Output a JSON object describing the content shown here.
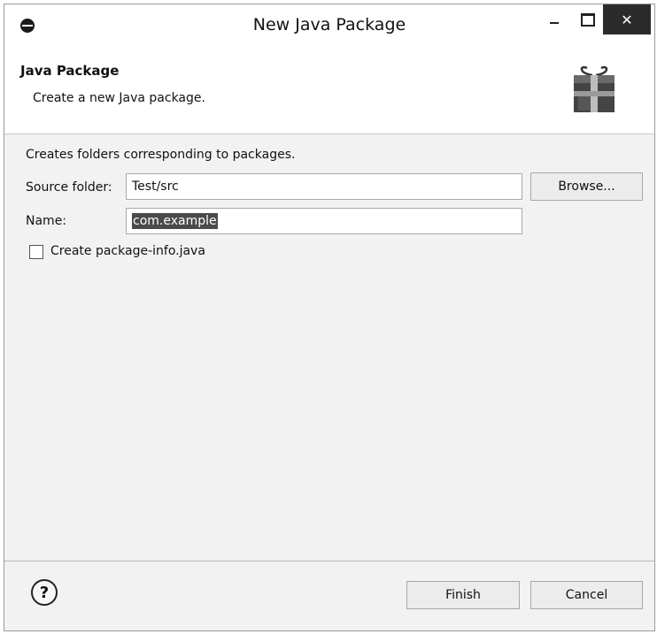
{
  "window": {
    "title": "New Java Package",
    "close_glyph": "✕"
  },
  "banner": {
    "title": "Java Package",
    "description": "Create a new Java package.",
    "icon": "package-icon"
  },
  "form": {
    "intro": "Creates folders corresponding to packages.",
    "source_folder_label": "Source folder:",
    "source_folder_value": "Test/src",
    "browse_label": "Browse...",
    "name_label": "Name:",
    "name_value": "com.example",
    "create_info_label": "Create package-info.java",
    "create_info_checked": false
  },
  "footer": {
    "help_glyph": "?",
    "finish_label": "Finish",
    "cancel_label": "Cancel"
  }
}
